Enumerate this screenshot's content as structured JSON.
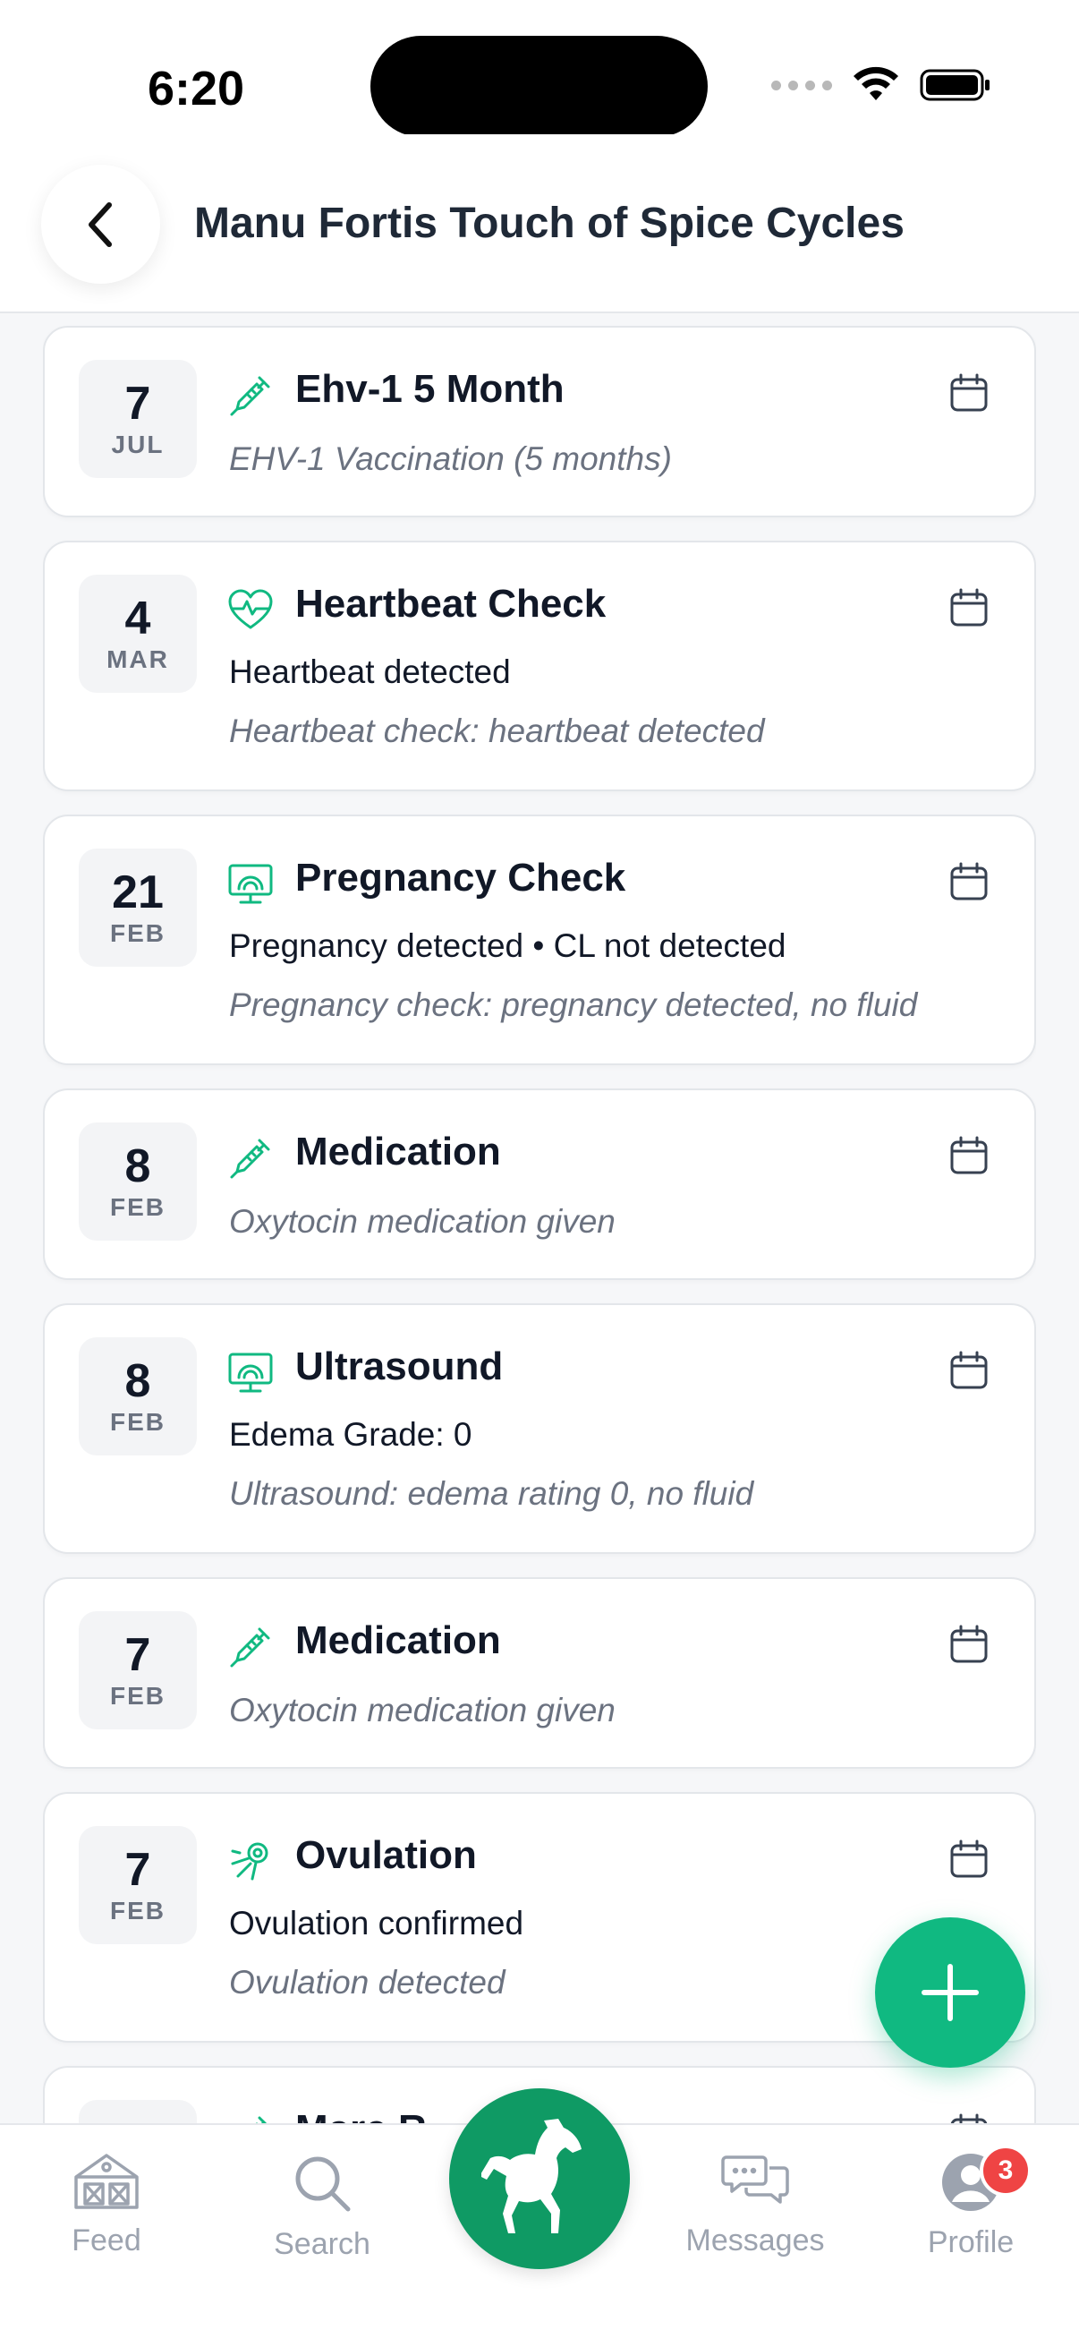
{
  "status_bar": {
    "time": "6:20"
  },
  "header": {
    "title": "Manu Fortis Touch of Spice Cycles"
  },
  "cards": [
    {
      "day": "7",
      "month": "JUL",
      "icon": "syringe-icon",
      "title": "Ehv-1 5 Month",
      "detail": "",
      "note": "EHV-1 Vaccination (5 months)"
    },
    {
      "day": "4",
      "month": "MAR",
      "icon": "heartbeat-icon",
      "title": "Heartbeat Check",
      "detail": "Heartbeat detected",
      "note": "Heartbeat check: heartbeat detected"
    },
    {
      "day": "21",
      "month": "FEB",
      "icon": "ultrasound-icon",
      "title": "Pregnancy Check",
      "detail": "Pregnancy detected • CL not detected",
      "note": "Pregnancy check: pregnancy detected, no fluid"
    },
    {
      "day": "8",
      "month": "FEB",
      "icon": "syringe-icon",
      "title": "Medication",
      "detail": "",
      "note": "Oxytocin medication given"
    },
    {
      "day": "8",
      "month": "FEB",
      "icon": "ultrasound-icon",
      "title": "Ultrasound",
      "detail": "Edema Grade: 0",
      "note": "Ultrasound: edema rating 0, no fluid"
    },
    {
      "day": "7",
      "month": "FEB",
      "icon": "syringe-icon",
      "title": "Medication",
      "detail": "",
      "note": "Oxytocin medication given"
    },
    {
      "day": "7",
      "month": "FEB",
      "icon": "ovulation-icon",
      "title": "Ovulation",
      "detail": "Ovulation confirmed",
      "note": "Ovulation detected"
    },
    {
      "day": "",
      "month": "",
      "icon": "syringe-icon",
      "title": "Mare R...",
      "detail": "",
      "note": ""
    }
  ],
  "tabbar": {
    "feed": "Feed",
    "search": "Search",
    "messages": "Messages",
    "profile": "Profile",
    "profile_badge": "3"
  },
  "colors": {
    "accent": "#10b981",
    "center_tab": "#0f9a64",
    "badge": "#ef4444"
  }
}
